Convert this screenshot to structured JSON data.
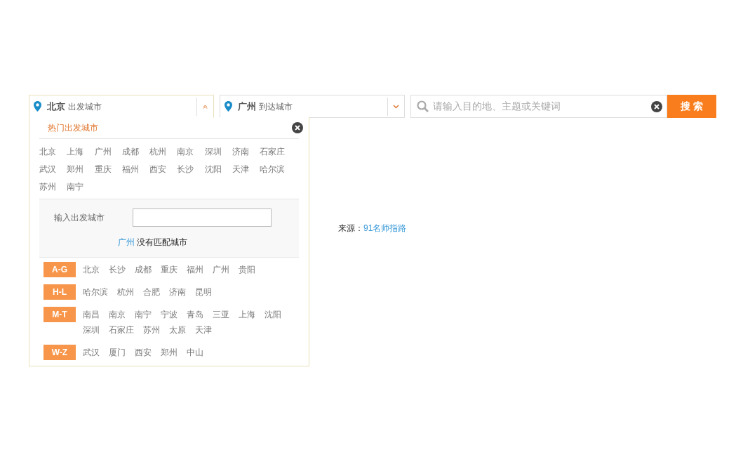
{
  "departure": {
    "city": "北京",
    "label": "出发城市",
    "expanded": true
  },
  "arrival": {
    "city": "广州",
    "label": "到达城市",
    "expanded": false
  },
  "search": {
    "placeholder": "请输入目的地、主题或关键词",
    "button": "搜 索"
  },
  "dropdown": {
    "title": "热门出发城市",
    "hot_cities": [
      "北京",
      "上海",
      "广州",
      "成都",
      "杭州",
      "南京",
      "深圳",
      "济南",
      "石家庄",
      "武汉",
      "郑州",
      "重庆",
      "福州",
      "西安",
      "长沙",
      "沈阳",
      "天津",
      "哈尔滨",
      "苏州",
      "南宁"
    ],
    "input_label": "输入出发城市",
    "no_match": "**广州** 没有匹配城市",
    "groups": [
      {
        "letters": "A-G",
        "cities": [
          "北京",
          "长沙",
          "成都",
          "重庆",
          "福州",
          "广州",
          "贵阳"
        ]
      },
      {
        "letters": "H-L",
        "cities": [
          "哈尔滨",
          "杭州",
          "合肥",
          "济南",
          "昆明"
        ]
      },
      {
        "letters": "M-T",
        "cities": [
          "南昌",
          "南京",
          "南宁",
          "宁波",
          "青岛",
          "三亚",
          "上海",
          "沈阳",
          "深圳",
          "石家庄",
          "苏州",
          "太原",
          "天津"
        ]
      },
      {
        "letters": "W-Z",
        "cities": [
          "武汉",
          "厦门",
          "西安",
          "郑州",
          "中山"
        ]
      }
    ]
  },
  "source": {
    "label": "来源：",
    "link": "91名师指路"
  }
}
